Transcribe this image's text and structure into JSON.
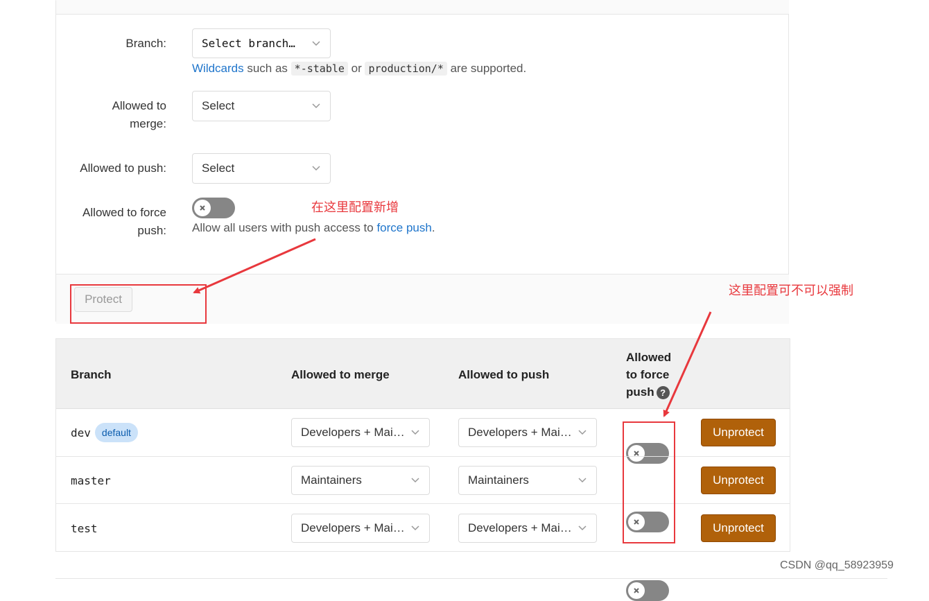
{
  "form": {
    "branch_label": "Branch:",
    "branch_select": "Select branch…",
    "branch_help_link": "Wildcards",
    "branch_help_1": " such as ",
    "branch_help_code1": "*-stable",
    "branch_help_2": " or ",
    "branch_help_code2": "production/*",
    "branch_help_3": " are supported.",
    "merge_label_1": "Allowed to",
    "merge_label_2": "merge:",
    "merge_select": "Select",
    "push_label": "Allowed to push:",
    "push_select": "Select",
    "force_label_1": "Allowed to force",
    "force_label_2": "push:",
    "force_help_1": "Allow all users with push access to ",
    "force_help_link": "force push",
    "force_help_2": ".",
    "force_toggle_on": false,
    "protect_button": "Protect"
  },
  "table": {
    "headers": {
      "branch": "Branch",
      "merge": "Allowed to merge",
      "push": "Allowed to push",
      "force_1": "Allowed",
      "force_2": "to force",
      "force_3": "push",
      "help": "?"
    },
    "rows": [
      {
        "branch": "dev",
        "badge": "default",
        "merge": "Developers + Mai…",
        "push": "Developers + Mai…",
        "force_push": false,
        "action": "Unprotect"
      },
      {
        "branch": "master",
        "badge": "",
        "merge": "Maintainers",
        "push": "Maintainers",
        "force_push": false,
        "action": "Unprotect"
      },
      {
        "branch": "test",
        "badge": "",
        "merge": "Developers + Mai…",
        "push": "Developers + Mai…",
        "force_push": false,
        "action": "Unprotect"
      }
    ]
  },
  "annotations": {
    "add_here": "在这里配置新增",
    "force_here": "这里配置可不可以强制",
    "color": "#e8383d"
  },
  "watermark": "CSDN @qq_58923959",
  "colors": {
    "unprotect_button": "#b0610a",
    "link": "#1f75cb",
    "toggle_off": "#868686"
  }
}
